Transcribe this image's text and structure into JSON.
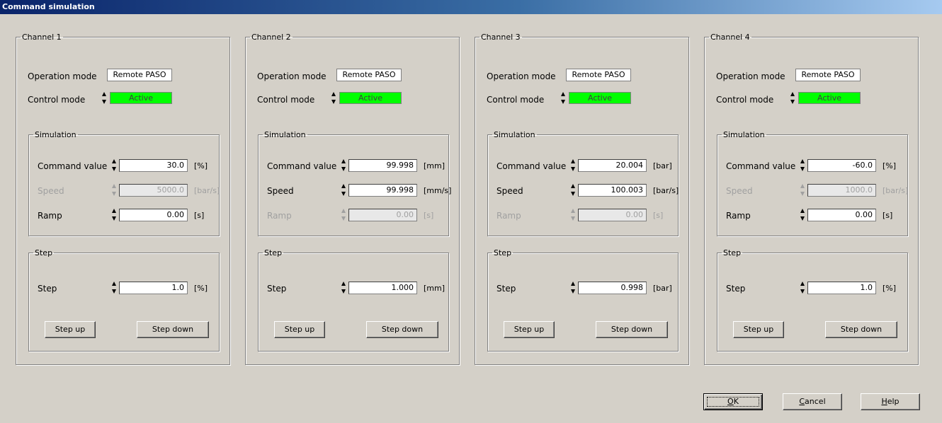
{
  "window": {
    "title": "Command simulation"
  },
  "labels": {
    "operation_mode": "Operation mode",
    "control_mode": "Control mode",
    "simulation": "Simulation",
    "command_value": "Command value",
    "speed": "Speed",
    "ramp": "Ramp",
    "step_group": "Step",
    "step": "Step",
    "step_up": "Step up",
    "step_down": "Step down"
  },
  "channels": [
    {
      "title": "Channel 1",
      "operation_mode": "Remote PASO",
      "control_mode": "Active",
      "command_value": "30.0",
      "command_unit": "[%]",
      "speed": "5000.0",
      "speed_unit": "[bar/s]",
      "speed_enabled": false,
      "ramp": "0.00",
      "ramp_unit": "[s]",
      "ramp_enabled": true,
      "step": "1.0",
      "step_unit": "[%]"
    },
    {
      "title": "Channel 2",
      "operation_mode": "Remote PASO",
      "control_mode": "Active",
      "command_value": "99.998",
      "command_unit": "[mm]",
      "speed": "99.998",
      "speed_unit": "[mm/s]",
      "speed_enabled": true,
      "ramp": "0.00",
      "ramp_unit": "[s]",
      "ramp_enabled": false,
      "step": "1.000",
      "step_unit": "[mm]"
    },
    {
      "title": "Channel 3",
      "operation_mode": "Remote PASO",
      "control_mode": "Active",
      "command_value": "20.004",
      "command_unit": "[bar]",
      "speed": "100.003",
      "speed_unit": "[bar/s]",
      "speed_enabled": true,
      "ramp": "0.00",
      "ramp_unit": "[s]",
      "ramp_enabled": false,
      "step": "0.998",
      "step_unit": "[bar]"
    },
    {
      "title": "Channel 4",
      "operation_mode": "Remote PASO",
      "control_mode": "Active",
      "command_value": "-60.0",
      "command_unit": "[%]",
      "speed": "1000.0",
      "speed_unit": "[bar/s]",
      "speed_enabled": false,
      "ramp": "0.00",
      "ramp_unit": "[s]",
      "ramp_enabled": true,
      "step": "1.0",
      "step_unit": "[%]"
    }
  ],
  "buttons": {
    "ok": {
      "accel": "O",
      "rest": "K"
    },
    "cancel": {
      "accel": "C",
      "rest": "ancel"
    },
    "help": {
      "accel": "H",
      "rest": "elp"
    }
  },
  "colors": {
    "active": "#00ff00",
    "titlebar_start": "#0a246a",
    "titlebar_end": "#a6caf0",
    "face": "#d4d0c8"
  },
  "icons": [
    "spin-updown-icon"
  ]
}
